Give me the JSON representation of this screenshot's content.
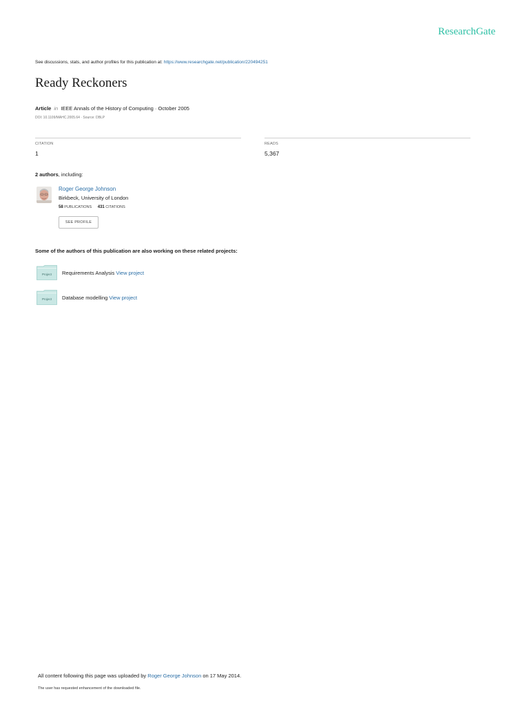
{
  "brand": {
    "logo_text": "ResearchGate"
  },
  "header": {
    "discussion_prefix": "See discussions, stats, and author profiles for this publication at: ",
    "discussion_link": "https://www.researchgate.net/publication/220494251"
  },
  "publication": {
    "title": "Ready Reckoners",
    "type": "Article",
    "in_label": "in",
    "venue_date": "IEEE Annals of the History of Computing · October 2005",
    "doi_source": "DOI: 10.1109/MAHC.2005.64 · Source: DBLP"
  },
  "stats": {
    "citation_label": "CITATION",
    "citation_value": "1",
    "reads_label": "READS",
    "reads_value": "5,367"
  },
  "authors": {
    "count_bold": "2 authors",
    "count_rest": ", including:",
    "list": [
      {
        "name": "Roger George Johnson",
        "affiliation": "Birkbeck, University of London",
        "publications_count": "58",
        "publications_label": "PUBLICATIONS",
        "citations_count": "431",
        "citations_label": "CITATIONS",
        "see_profile_label": "SEE PROFILE"
      }
    ]
  },
  "projects": {
    "heading": "Some of the authors of this publication are also working on these related projects:",
    "icon_label": "Project",
    "items": [
      {
        "name": "Requirements Analysis",
        "link": "View project"
      },
      {
        "name": "Database modelling",
        "link": "View project"
      }
    ]
  },
  "footer": {
    "uploaded_prefix": "All content following this page was uploaded by ",
    "uploaded_author": "Roger George Johnson",
    "uploaded_suffix": " on 17 May 2014.",
    "note": "The user has requested enhancement of the downloaded file."
  },
  "colors": {
    "brand": "#2bbfa4",
    "link": "#2a6ea6",
    "project_icon": "#c9e7e4"
  }
}
